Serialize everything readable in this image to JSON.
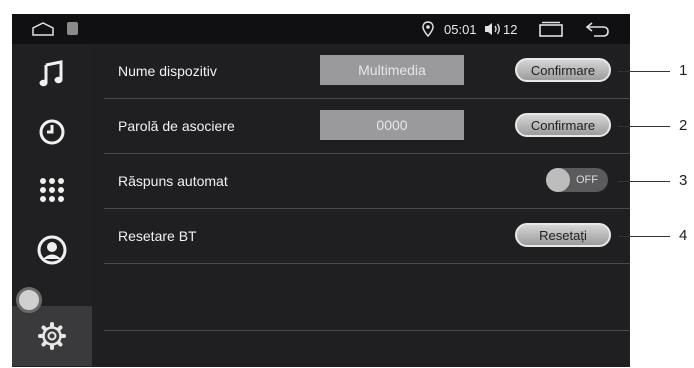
{
  "status_bar": {
    "time": "05:01",
    "volume_level": "12"
  },
  "sidebar": {
    "items": [
      {
        "icon": "music-note-icon"
      },
      {
        "icon": "clock-icon"
      },
      {
        "icon": "keypad-icon"
      },
      {
        "icon": "contact-icon"
      },
      {
        "icon": "gear-icon",
        "active": true
      }
    ]
  },
  "settings": {
    "device_name_label": "Nume dispozitiv",
    "device_name_value": "Multimedia",
    "device_name_button": "Confirmare",
    "pair_password_label": "Parolă de asociere",
    "pair_password_value": "0000",
    "pair_password_button": "Confirmare",
    "auto_answer_label": "Răspuns automat",
    "auto_answer_state": "OFF",
    "reset_label": "Resetare BT",
    "reset_button": "Resetați"
  },
  "callouts": [
    "1",
    "2",
    "3",
    "4"
  ],
  "colors": {
    "screen_bg": "#1f1f21",
    "sidebar_bg": "#202022",
    "active_item": "#3a3a3c",
    "field_bg": "#9a9a9c"
  }
}
